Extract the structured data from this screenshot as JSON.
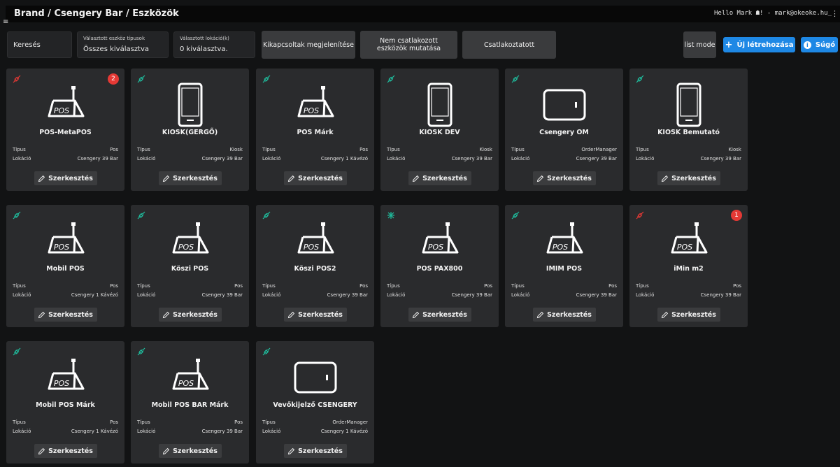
{
  "header": {
    "breadcrumb": "Brand / Csengery Bar / Eszközök",
    "user_text": "Hello Mark ☗! - mark@okeoke.hu_"
  },
  "filters": {
    "search_label": "Keresés",
    "device_types_label": "Választott eszköz típusok",
    "device_types_value": "Összes kiválasztva",
    "locations_label": "Választott lokáció(k)",
    "locations_value": "0 kiválasztva.",
    "show_disconnected": "Kikapcsoltak megjelenítése",
    "show_unconnected": "Nem csatlakozott eszközök mutatása",
    "connected": "Csatlakoztatott",
    "list_mode": "list mode",
    "create_new": "Új létrehozása",
    "help": "Súgó"
  },
  "labels": {
    "type": "Típus",
    "location": "Lokáció",
    "edit": "Szerkesztés"
  },
  "colors": {
    "connected": "#1fbf9f",
    "disconnected": "#e53935",
    "accent": "#1e88e5"
  },
  "devices": [
    {
      "name": "POS-MetaPOS",
      "type": "Pos",
      "location": "Csengery 39 Bar",
      "icon": "pos-terminal-icon",
      "status": "disconnected",
      "badge": "2"
    },
    {
      "name": "KIOSK(GERGŐ)",
      "type": "Kiosk",
      "location": "Csengery 39 Bar",
      "icon": "kiosk-icon",
      "status": "connected",
      "badge": ""
    },
    {
      "name": "POS Márk",
      "type": "Pos",
      "location": "Csengery 1 Kávézó",
      "icon": "pos-terminal-icon",
      "status": "connected",
      "badge": ""
    },
    {
      "name": "KIOSK DEV",
      "type": "Kiosk",
      "location": "Csengery 39 Bar",
      "icon": "kiosk-icon",
      "status": "connected",
      "badge": ""
    },
    {
      "name": "Csengery OM",
      "type": "OrderManager",
      "location": "Csengery 39 Bar",
      "icon": "tablet-icon",
      "status": "connected",
      "badge": ""
    },
    {
      "name": "KIOSK Bemutató",
      "type": "Kiosk",
      "location": "Csengery 39 Bar",
      "icon": "kiosk-icon",
      "status": "connected",
      "badge": ""
    },
    {
      "name": "Mobil POS",
      "type": "Pos",
      "location": "Csengery 1 Kávézó",
      "icon": "pos-terminal-icon",
      "status": "connected",
      "badge": ""
    },
    {
      "name": "Köszi POS",
      "type": "Pos",
      "location": "Csengery 39 Bar",
      "icon": "pos-terminal-icon",
      "status": "connected",
      "badge": ""
    },
    {
      "name": "Köszi POS2",
      "type": "Pos",
      "location": "Csengery 39 Bar",
      "icon": "pos-terminal-icon",
      "status": "connected",
      "badge": ""
    },
    {
      "name": "POS PAX800",
      "type": "Pos",
      "location": "Csengery 39 Bar",
      "icon": "pos-terminal-icon",
      "status": "unplugged",
      "badge": ""
    },
    {
      "name": "IMIM POS",
      "type": "Pos",
      "location": "Csengery 39 Bar",
      "icon": "pos-terminal-icon",
      "status": "connected",
      "badge": ""
    },
    {
      "name": "iMin m2",
      "type": "Pos",
      "location": "Csengery 39 Bar",
      "icon": "pos-terminal-icon",
      "status": "disconnected",
      "badge": "1"
    },
    {
      "name": "Mobil POS Márk",
      "type": "Pos",
      "location": "Csengery 1 Kávézó",
      "icon": "pos-terminal-icon",
      "status": "connected",
      "badge": ""
    },
    {
      "name": "Mobil POS BAR Márk",
      "type": "Pos",
      "location": "Csengery 39 Bar",
      "icon": "pos-terminal-icon",
      "status": "connected",
      "badge": ""
    },
    {
      "name": "Vevőkijelző CSENGERY",
      "type": "OrderManager",
      "location": "Csengery 1 Kávézó",
      "icon": "tablet-icon",
      "status": "connected",
      "badge": ""
    }
  ]
}
